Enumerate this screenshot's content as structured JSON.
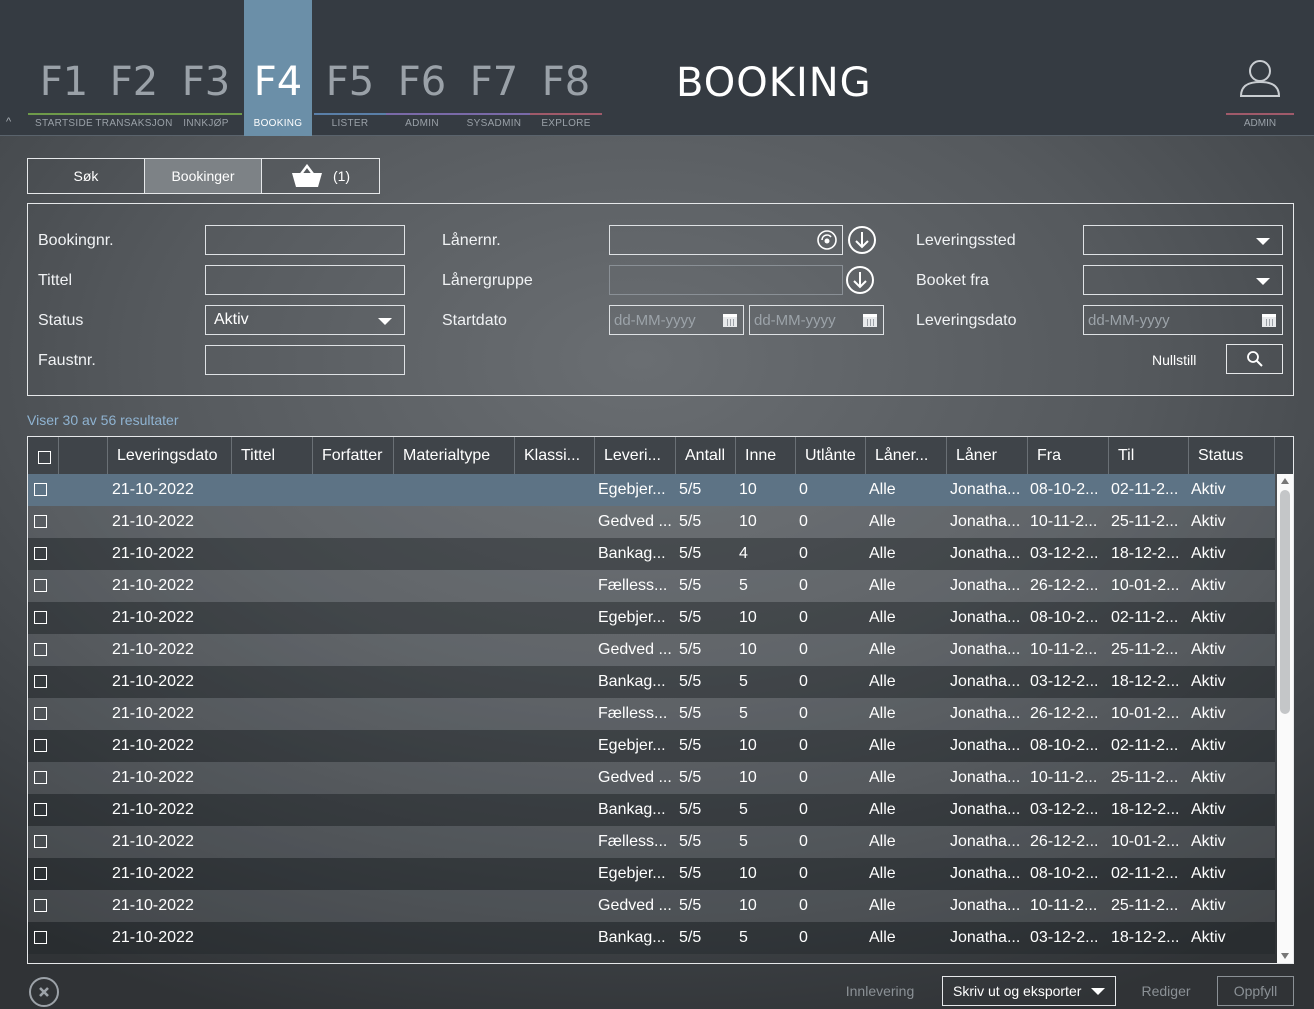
{
  "nav": {
    "keys": [
      {
        "key": "F1",
        "label": "STARTSIDE",
        "line": "#6e9a4a"
      },
      {
        "key": "F2",
        "label": "TRANSAKSJON",
        "line": "#6e9a4a"
      },
      {
        "key": "F3",
        "label": "INNKJØP",
        "line": "#6e9a4a"
      },
      {
        "key": "F4",
        "label": "BOOKING",
        "line": "#6b8fa8"
      },
      {
        "key": "F5",
        "label": "LISTER",
        "line": "#5a7fa8"
      },
      {
        "key": "F6",
        "label": "ADMIN",
        "line": "#7a6aa8"
      },
      {
        "key": "F7",
        "label": "SYSADMIN",
        "line": "#7a6aa8"
      },
      {
        "key": "F8",
        "label": "EXPLORE",
        "line": "#a05a6a"
      }
    ],
    "active": "F4",
    "collapse_icon": "^",
    "admin_label": "ADMIN"
  },
  "page_title": "BOOKING",
  "tabs": {
    "search": "Søk",
    "bookings": "Bookinger",
    "basket_count": "(1)"
  },
  "form": {
    "bookingnr_label": "Bookingnr.",
    "tittel_label": "Tittel",
    "status_label": "Status",
    "status_value": "Aktiv",
    "faustnr_label": "Faustnr.",
    "lanernr_label": "Lånernr.",
    "lanergruppe_label": "Lånergruppe",
    "startdato_label": "Startdato",
    "date_placeholder": "dd-MM-yyyy",
    "leveringssted_label": "Leveringssted",
    "booket_fra_label": "Booket fra",
    "leveringsdato_label": "Leveringsdato",
    "reset_label": "Nullstill"
  },
  "results_text": "Viser 30 av 56 resultater",
  "grid": {
    "columns": [
      "Leveringsdato",
      "Tittel",
      "Forfatter",
      "Materialtype",
      "Klassi...",
      "Leveri...",
      "Antall",
      "Inne",
      "Utlånte",
      "Låner...",
      "Låner",
      "Fra",
      "Til",
      "Status"
    ],
    "rows": [
      [
        "21-10-2022",
        "Egebjer...",
        "5/5",
        "10",
        "0",
        "Alle",
        "Jonatha...",
        "08-10-2...",
        "02-11-2...",
        "Aktiv"
      ],
      [
        "21-10-2022",
        "Gedved ...",
        "5/5",
        "10",
        "0",
        "Alle",
        "Jonatha...",
        "10-11-2...",
        "25-11-2...",
        "Aktiv"
      ],
      [
        "21-10-2022",
        "Bankag...",
        "5/5",
        "4",
        "0",
        "Alle",
        "Jonatha...",
        "03-12-2...",
        "18-12-2...",
        "Aktiv"
      ],
      [
        "21-10-2022",
        "Fælless...",
        "5/5",
        "5",
        "0",
        "Alle",
        "Jonatha...",
        "26-12-2...",
        "10-01-2...",
        "Aktiv"
      ],
      [
        "21-10-2022",
        "Egebjer...",
        "5/5",
        "10",
        "0",
        "Alle",
        "Jonatha...",
        "08-10-2...",
        "02-11-2...",
        "Aktiv"
      ],
      [
        "21-10-2022",
        "Gedved ...",
        "5/5",
        "10",
        "0",
        "Alle",
        "Jonatha...",
        "10-11-2...",
        "25-11-2...",
        "Aktiv"
      ],
      [
        "21-10-2022",
        "Bankag...",
        "5/5",
        "5",
        "0",
        "Alle",
        "Jonatha...",
        "03-12-2...",
        "18-12-2...",
        "Aktiv"
      ],
      [
        "21-10-2022",
        "Fælless...",
        "5/5",
        "5",
        "0",
        "Alle",
        "Jonatha...",
        "26-12-2...",
        "10-01-2...",
        "Aktiv"
      ],
      [
        "21-10-2022",
        "Egebjer...",
        "5/5",
        "10",
        "0",
        "Alle",
        "Jonatha...",
        "08-10-2...",
        "02-11-2...",
        "Aktiv"
      ],
      [
        "21-10-2022",
        "Gedved ...",
        "5/5",
        "10",
        "0",
        "Alle",
        "Jonatha...",
        "10-11-2...",
        "25-11-2...",
        "Aktiv"
      ],
      [
        "21-10-2022",
        "Bankag...",
        "5/5",
        "5",
        "0",
        "Alle",
        "Jonatha...",
        "03-12-2...",
        "18-12-2...",
        "Aktiv"
      ],
      [
        "21-10-2022",
        "Fælless...",
        "5/5",
        "5",
        "0",
        "Alle",
        "Jonatha...",
        "26-12-2...",
        "10-01-2...",
        "Aktiv"
      ],
      [
        "21-10-2022",
        "Egebjer...",
        "5/5",
        "10",
        "0",
        "Alle",
        "Jonatha...",
        "08-10-2...",
        "02-11-2...",
        "Aktiv"
      ],
      [
        "21-10-2022",
        "Gedved ...",
        "5/5",
        "10",
        "0",
        "Alle",
        "Jonatha...",
        "10-11-2...",
        "25-11-2...",
        "Aktiv"
      ],
      [
        "21-10-2022",
        "Bankag...",
        "5/5",
        "5",
        "0",
        "Alle",
        "Jonatha...",
        "03-12-2...",
        "18-12-2...",
        "Aktiv"
      ]
    ],
    "selected_row": 0
  },
  "footer": {
    "innlevering": "Innlevering",
    "print_export": "Skriv ut og eksporter",
    "rediger": "Rediger",
    "oppfyll": "Oppfyll"
  },
  "colors": {
    "accent": "#6b8fa8",
    "selected_row": "#5d7385",
    "link": "#8fb3d1"
  }
}
